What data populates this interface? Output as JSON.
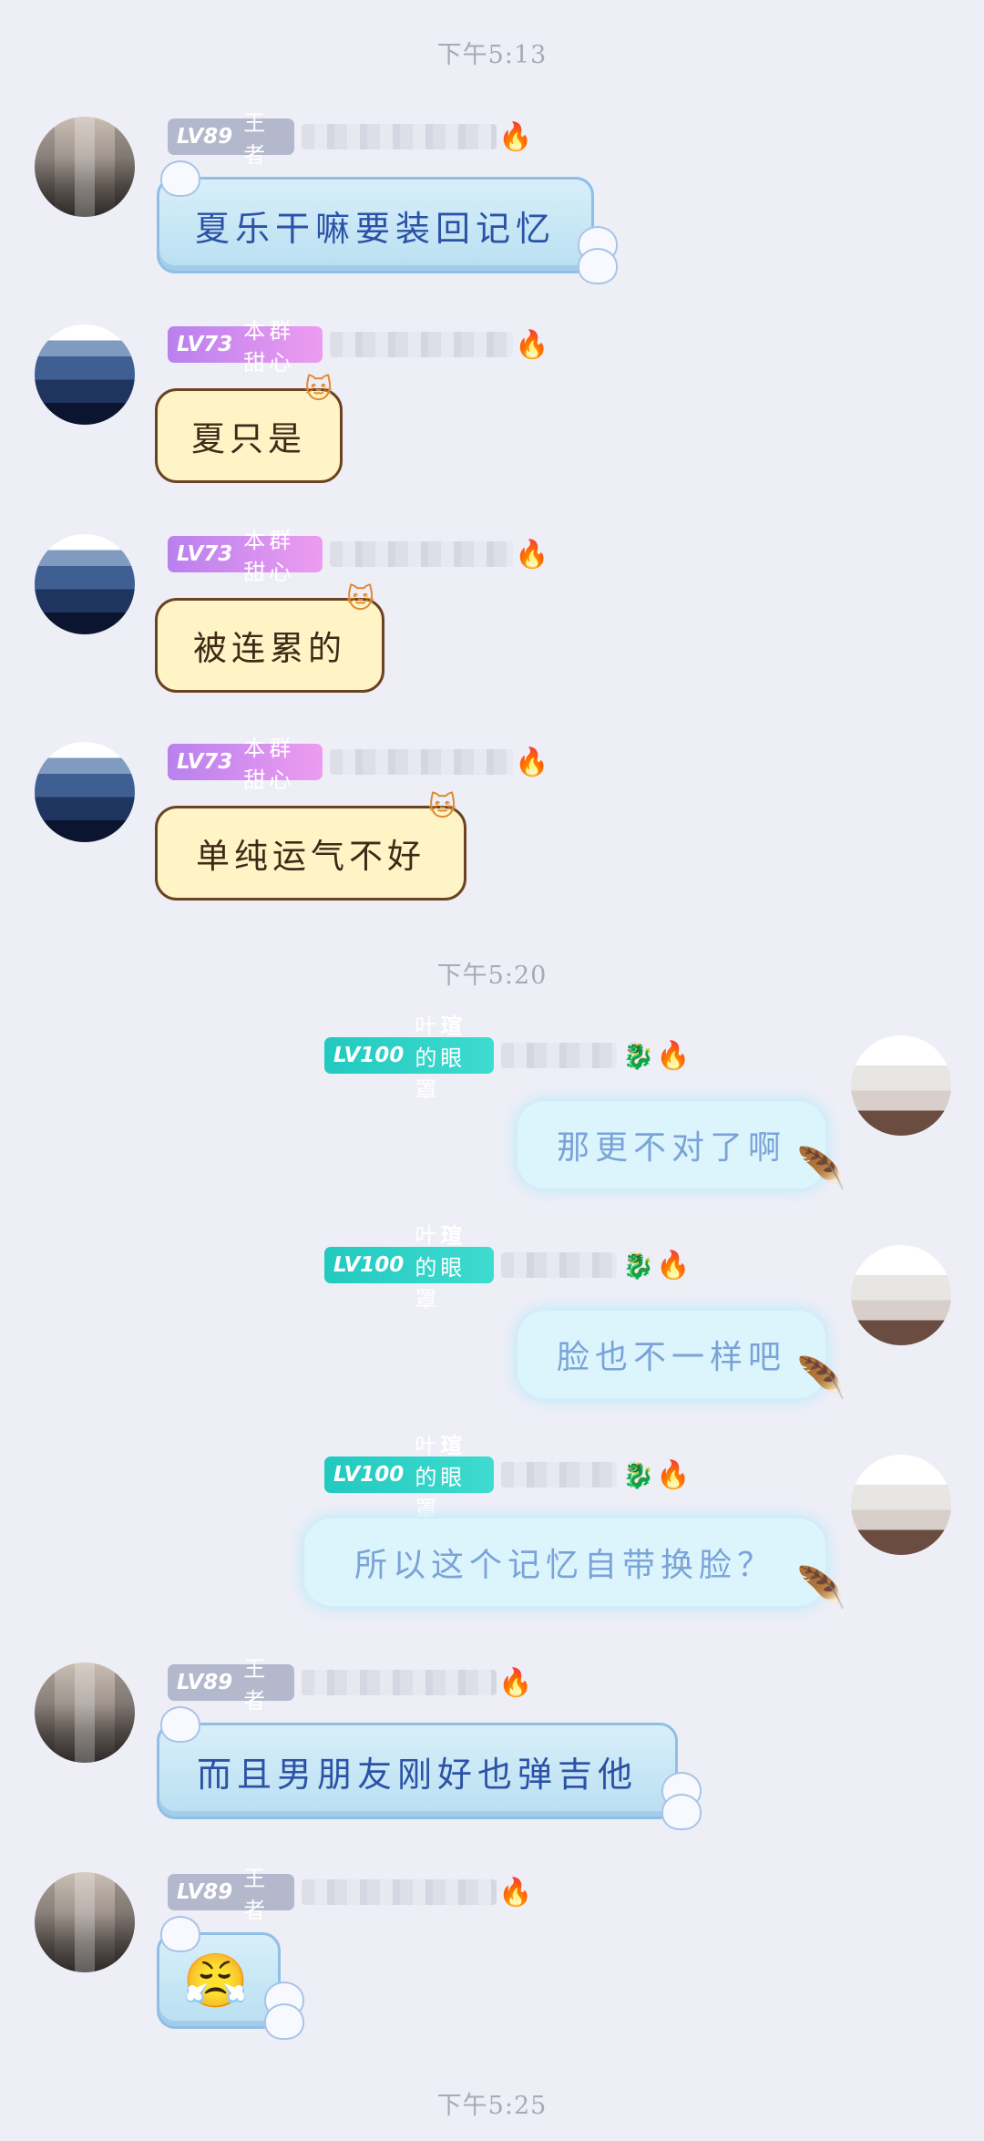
{
  "timestamps": [
    "下午5:13",
    "下午5:20",
    "下午5:25"
  ],
  "messages": [
    {
      "badge_lv": "LV89",
      "badge_title": "王者",
      "text": "夏乐干嘛要装回记忆"
    },
    {
      "badge_lv": "LV73",
      "badge_title": "本群甜心",
      "text": "夏只是"
    },
    {
      "badge_lv": "LV73",
      "badge_title": "本群甜心",
      "text": "被连累的"
    },
    {
      "badge_lv": "LV73",
      "badge_title": "本群甜心",
      "text": "单纯运气不好"
    },
    {
      "badge_lv": "LV100",
      "badge_title_a": "叶",
      "badge_title_b": "瑄",
      "badge_title_c": "的眼罩",
      "text": "那更不对了啊"
    },
    {
      "badge_lv": "LV100",
      "badge_title_a": "叶",
      "badge_title_b": "瑄",
      "badge_title_c": "的眼罩",
      "text": "脸也不一样吧"
    },
    {
      "badge_lv": "LV100",
      "badge_title_a": "叶",
      "badge_title_b": "瑄",
      "badge_title_c": "的眼罩",
      "text": "所以这个记忆自带换脸？"
    },
    {
      "badge_lv": "LV89",
      "badge_title": "王者",
      "text": "而且男朋友刚好也弹吉他"
    },
    {
      "badge_lv": "LV89",
      "badge_title": "王者",
      "text": "😤"
    }
  ],
  "icons": {
    "fire": "🔥",
    "dragon": "🐉",
    "cat": "🐱",
    "feather": "🪶"
  }
}
